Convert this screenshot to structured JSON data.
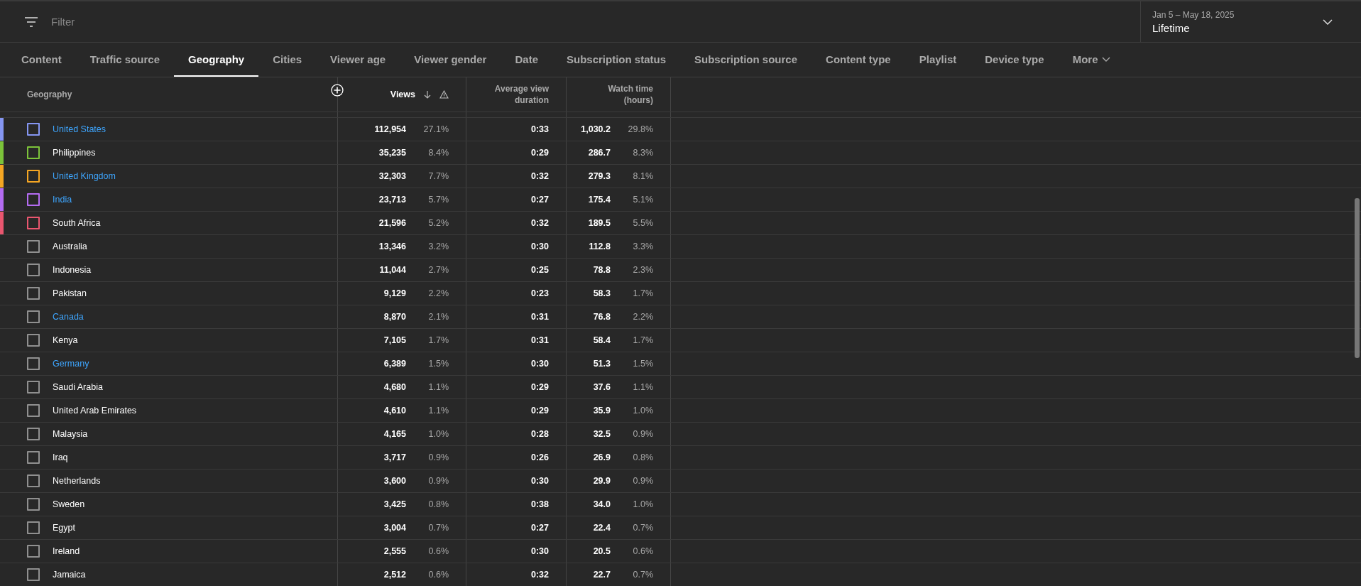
{
  "filter": {
    "placeholder": "Filter"
  },
  "date_range": {
    "range": "Jan 5 – May 18, 2025",
    "period": "Lifetime"
  },
  "tabs": [
    {
      "label": "Content",
      "selected": false
    },
    {
      "label": "Traffic source",
      "selected": false
    },
    {
      "label": "Geography",
      "selected": true
    },
    {
      "label": "Cities",
      "selected": false
    },
    {
      "label": "Viewer age",
      "selected": false
    },
    {
      "label": "Viewer gender",
      "selected": false
    },
    {
      "label": "Date",
      "selected": false
    },
    {
      "label": "Subscription status",
      "selected": false
    },
    {
      "label": "Subscription source",
      "selected": false
    },
    {
      "label": "Content type",
      "selected": false
    },
    {
      "label": "Playlist",
      "selected": false
    },
    {
      "label": "Device type",
      "selected": false
    }
  ],
  "more_tab": {
    "label": "More"
  },
  "table": {
    "columns": [
      "Geography",
      "Views",
      "Average view duration",
      "Watch time (hours)"
    ],
    "rows": [
      {
        "name": "United States",
        "linked": true,
        "color": "#8596f2",
        "checked": false,
        "views": "112,954",
        "views_pct": "27.1%",
        "avg": "0:33",
        "watch": "1,030.2",
        "watch_pct": "29.8%"
      },
      {
        "name": "Philippines",
        "linked": false,
        "color": "#7cc33a",
        "checked": false,
        "views": "35,235",
        "views_pct": "8.4%",
        "avg": "0:29",
        "watch": "286.7",
        "watch_pct": "8.3%"
      },
      {
        "name": "United Kingdom",
        "linked": true,
        "color": "#f5a623",
        "checked": false,
        "views": "32,303",
        "views_pct": "7.7%",
        "avg": "0:32",
        "watch": "279.3",
        "watch_pct": "8.1%"
      },
      {
        "name": "India",
        "linked": true,
        "color": "#b46cf2",
        "checked": false,
        "views": "23,713",
        "views_pct": "5.7%",
        "avg": "0:27",
        "watch": "175.4",
        "watch_pct": "5.1%"
      },
      {
        "name": "South Africa",
        "linked": false,
        "color": "#e9566f",
        "checked": false,
        "views": "21,596",
        "views_pct": "5.2%",
        "avg": "0:32",
        "watch": "189.5",
        "watch_pct": "5.5%"
      },
      {
        "name": "Australia",
        "linked": false,
        "checked": false,
        "views": "13,346",
        "views_pct": "3.2%",
        "avg": "0:30",
        "watch": "112.8",
        "watch_pct": "3.3%"
      },
      {
        "name": "Indonesia",
        "linked": false,
        "checked": false,
        "views": "11,044",
        "views_pct": "2.7%",
        "avg": "0:25",
        "watch": "78.8",
        "watch_pct": "2.3%"
      },
      {
        "name": "Pakistan",
        "linked": false,
        "checked": false,
        "views": "9,129",
        "views_pct": "2.2%",
        "avg": "0:23",
        "watch": "58.3",
        "watch_pct": "1.7%"
      },
      {
        "name": "Canada",
        "linked": true,
        "checked": false,
        "views": "8,870",
        "views_pct": "2.1%",
        "avg": "0:31",
        "watch": "76.8",
        "watch_pct": "2.2%"
      },
      {
        "name": "Kenya",
        "linked": false,
        "checked": false,
        "views": "7,105",
        "views_pct": "1.7%",
        "avg": "0:31",
        "watch": "58.4",
        "watch_pct": "1.7%"
      },
      {
        "name": "Germany",
        "linked": true,
        "checked": false,
        "views": "6,389",
        "views_pct": "1.5%",
        "avg": "0:30",
        "watch": "51.3",
        "watch_pct": "1.5%"
      },
      {
        "name": "Saudi Arabia",
        "linked": false,
        "checked": false,
        "views": "4,680",
        "views_pct": "1.1%",
        "avg": "0:29",
        "watch": "37.6",
        "watch_pct": "1.1%"
      },
      {
        "name": "United Arab Emirates",
        "linked": false,
        "checked": false,
        "views": "4,610",
        "views_pct": "1.1%",
        "avg": "0:29",
        "watch": "35.9",
        "watch_pct": "1.0%"
      },
      {
        "name": "Malaysia",
        "linked": false,
        "checked": false,
        "views": "4,165",
        "views_pct": "1.0%",
        "avg": "0:28",
        "watch": "32.5",
        "watch_pct": "0.9%"
      },
      {
        "name": "Iraq",
        "linked": false,
        "checked": false,
        "views": "3,717",
        "views_pct": "0.9%",
        "avg": "0:26",
        "watch": "26.9",
        "watch_pct": "0.8%"
      },
      {
        "name": "Netherlands",
        "linked": false,
        "checked": false,
        "views": "3,600",
        "views_pct": "0.9%",
        "avg": "0:30",
        "watch": "29.9",
        "watch_pct": "0.9%"
      },
      {
        "name": "Sweden",
        "linked": false,
        "checked": false,
        "views": "3,425",
        "views_pct": "0.8%",
        "avg": "0:38",
        "watch": "34.0",
        "watch_pct": "1.0%"
      },
      {
        "name": "Egypt",
        "linked": false,
        "checked": false,
        "views": "3,004",
        "views_pct": "0.7%",
        "avg": "0:27",
        "watch": "22.4",
        "watch_pct": "0.7%"
      },
      {
        "name": "Ireland",
        "linked": false,
        "checked": false,
        "views": "2,555",
        "views_pct": "0.6%",
        "avg": "0:30",
        "watch": "20.5",
        "watch_pct": "0.6%"
      },
      {
        "name": "Jamaica",
        "linked": false,
        "checked": false,
        "views": "2,512",
        "views_pct": "0.6%",
        "avg": "0:32",
        "watch": "22.7",
        "watch_pct": "0.7%"
      }
    ]
  }
}
